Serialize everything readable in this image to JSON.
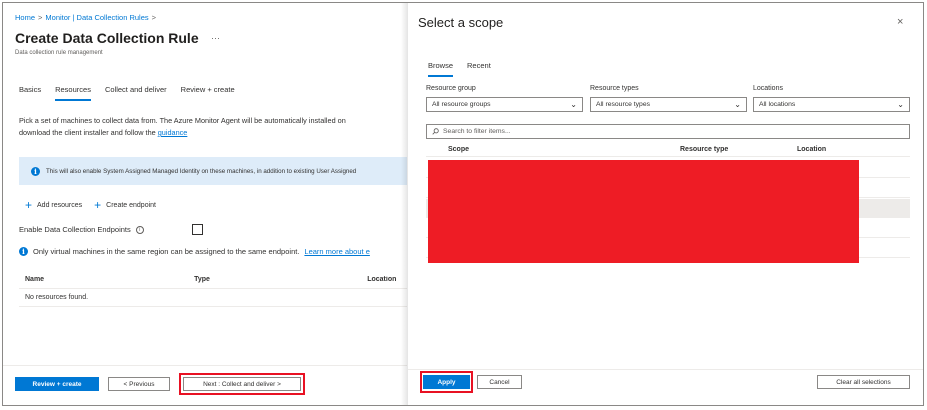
{
  "left": {
    "breadcrumb": [
      "Home",
      "Monitor | Data Collection Rules"
    ],
    "breadcrumb_sep": ">",
    "title": "Create Data Collection Rule",
    "more": "···",
    "subtitle": "Data collection rule management",
    "tabs": [
      "Basics",
      "Resources",
      "Collect and deliver",
      "Review + create"
    ],
    "description_line1": "Pick a set of machines to collect data from. The Azure Monitor Agent will be automatically installed on",
    "description_line2": "download the client installer and follow the",
    "guidance_link": "guidance",
    "info_text": "This will also enable System Assigned Managed Identity on these machines, in addition to existing User Assigned",
    "add_resources": "Add resources",
    "create_endpoint": "Create endpoint",
    "enable_endpoints_label": "Enable Data Collection Endpoints",
    "note_text": "Only virtual machines in the same region can be assigned to the same endpoint.",
    "learn_more": "Learn more about e",
    "columns": [
      "Name",
      "Type",
      "Location"
    ],
    "empty_text": "No resources found.",
    "review_create": "Review + create",
    "previous": "< Previous",
    "next": "Next : Collect and deliver >"
  },
  "scope": {
    "title": "Select a scope",
    "close": "×",
    "tabs": [
      "Browse",
      "Recent"
    ],
    "resource_group_label": "Resource group",
    "resource_group_value": "All resource groups",
    "resource_types_label": "Resource types",
    "resource_types_value": "All resource types",
    "locations_label": "Locations",
    "locations_value": "All locations",
    "filter_placeholder": "Search to filter items...",
    "columns": [
      "Scope",
      "Resource type",
      "Location"
    ],
    "apply": "Apply",
    "cancel": "Cancel",
    "clear_all": "Clear all selections"
  },
  "colors": {
    "accent": "#0078d4",
    "highlight": "#e81123",
    "redaction": "#ee1c25",
    "info_bar": "#deecf9"
  }
}
